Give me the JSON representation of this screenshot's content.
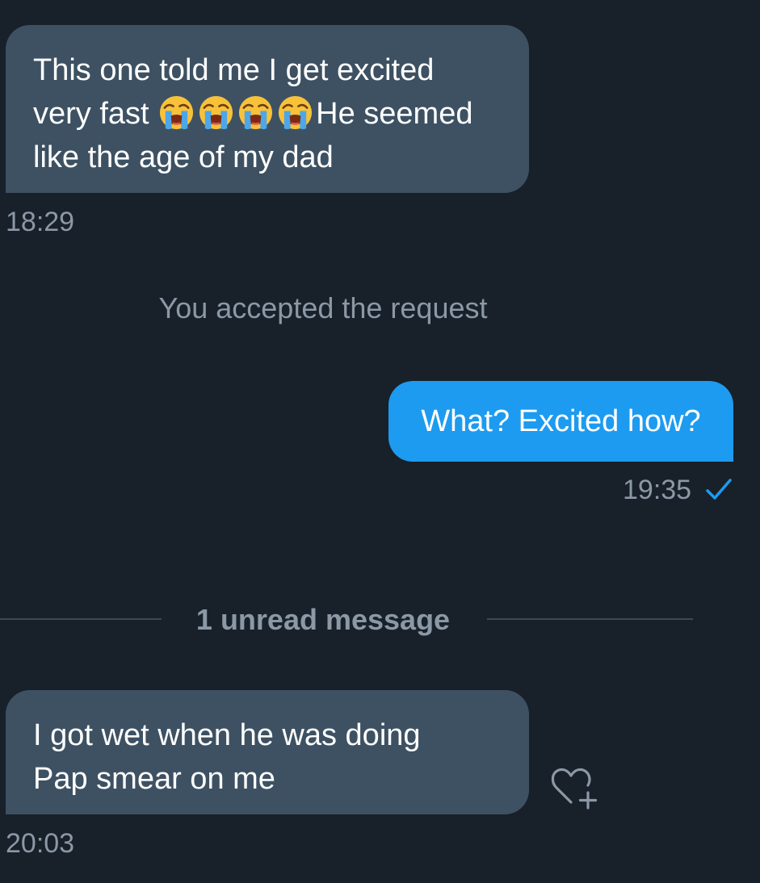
{
  "colors": {
    "background": "#18202a",
    "incoming_bubble": "#3d5162",
    "outgoing_bubble": "#1d9bf0",
    "muted_text": "#8b98a5",
    "check": "#1d9bf0"
  },
  "messages": [
    {
      "direction": "incoming",
      "line1": "This one told me I get excited",
      "line2_pre": "very fast ",
      "line2_emojis": [
        "loudly-crying-face",
        "loudly-crying-face",
        "loudly-crying-face",
        "loudly-crying-face"
      ],
      "line2_post": "He seemed",
      "line3": "like the age of my dad",
      "time": "18:29"
    },
    {
      "direction": "outgoing",
      "text": "What? Excited how?",
      "time": "19:35",
      "status_icon": "check-icon"
    },
    {
      "direction": "incoming",
      "line1": "I got wet when he was doing",
      "line2": "Pap smear on me",
      "time": "20:03",
      "reaction_icon": "heart-plus-icon"
    }
  ],
  "system_notice": "You accepted the request",
  "unread_divider": "1 unread message"
}
